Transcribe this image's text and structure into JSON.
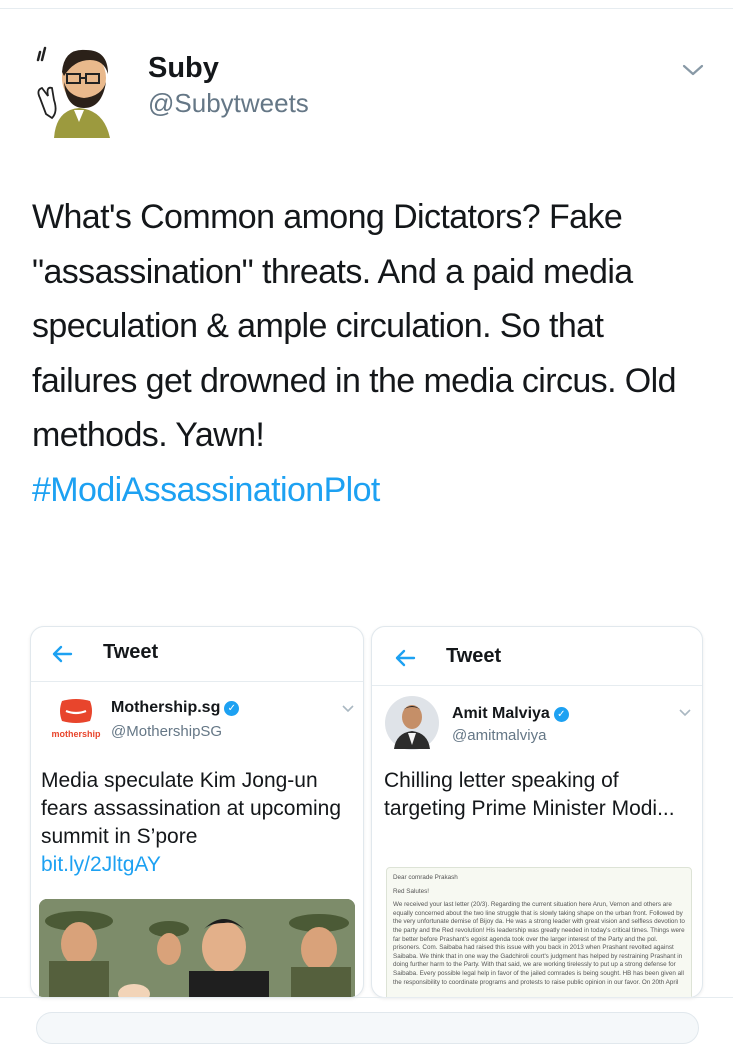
{
  "author": {
    "name": "Suby",
    "handle": "@Subytweets"
  },
  "tweet": {
    "text": "What's Common among Dictators? Fake \"assassination\" threats. And a paid media speculation & ample circulation. So that failures get drowned in the media circus. Old methods. Yawn!",
    "hashtag": "#ModiAssassinationPlot"
  },
  "screenshot_left": {
    "nav_title": "Tweet",
    "name": "Mothership.sg",
    "handle": "@MothershipSG",
    "logo_text": "mothership",
    "text": "Media speculate Kim Jong-un fears assassination at upcoming summit in S’pore",
    "link": "bit.ly/2JltgAY"
  },
  "screenshot_right": {
    "nav_title": "Tweet",
    "name": "Amit Malviya",
    "handle": "@amitmalviya",
    "text": "Chilling letter speaking of targeting Prime Minister Modi...",
    "letter": {
      "salutation": "Dear comrade Prakash",
      "greeting": "Red Salutes!",
      "body_1": "We received your last letter (20/3). Regarding the current situation here Arun, Vernon and others are equally concerned about the two line struggle that is slowly taking shape on the urban front. Followed by the very unfortunate demise of Bijoy da. He was a strong leader with great vision and selfless devotion to the party and the Red revolution! His leadership was greatly needed in today's critical times. Things were far better before Prashant's egoist agenda took over the larger interest of the Party and the pol. prisoners. Com. Saibaba had raised this issue with you back in 2013 when Prashant revolted against Saibaba. We think that in one way the Gadchiroli court's judgment has helped by restraining Prashant in doing further harm to the Party. With that said, we are working tirelessly to put up a strong defense for Saibaba. Every possible legal help in favor of the jailed comrades is being sought. HB has been given all the responsibility to coordinate programs and protests to raise public opinion in our favor. On 20th April"
    }
  },
  "colors": {
    "accent": "#1da1f2",
    "text": "#14171a",
    "secondary": "#657786",
    "mothership_red": "#e8452c"
  }
}
